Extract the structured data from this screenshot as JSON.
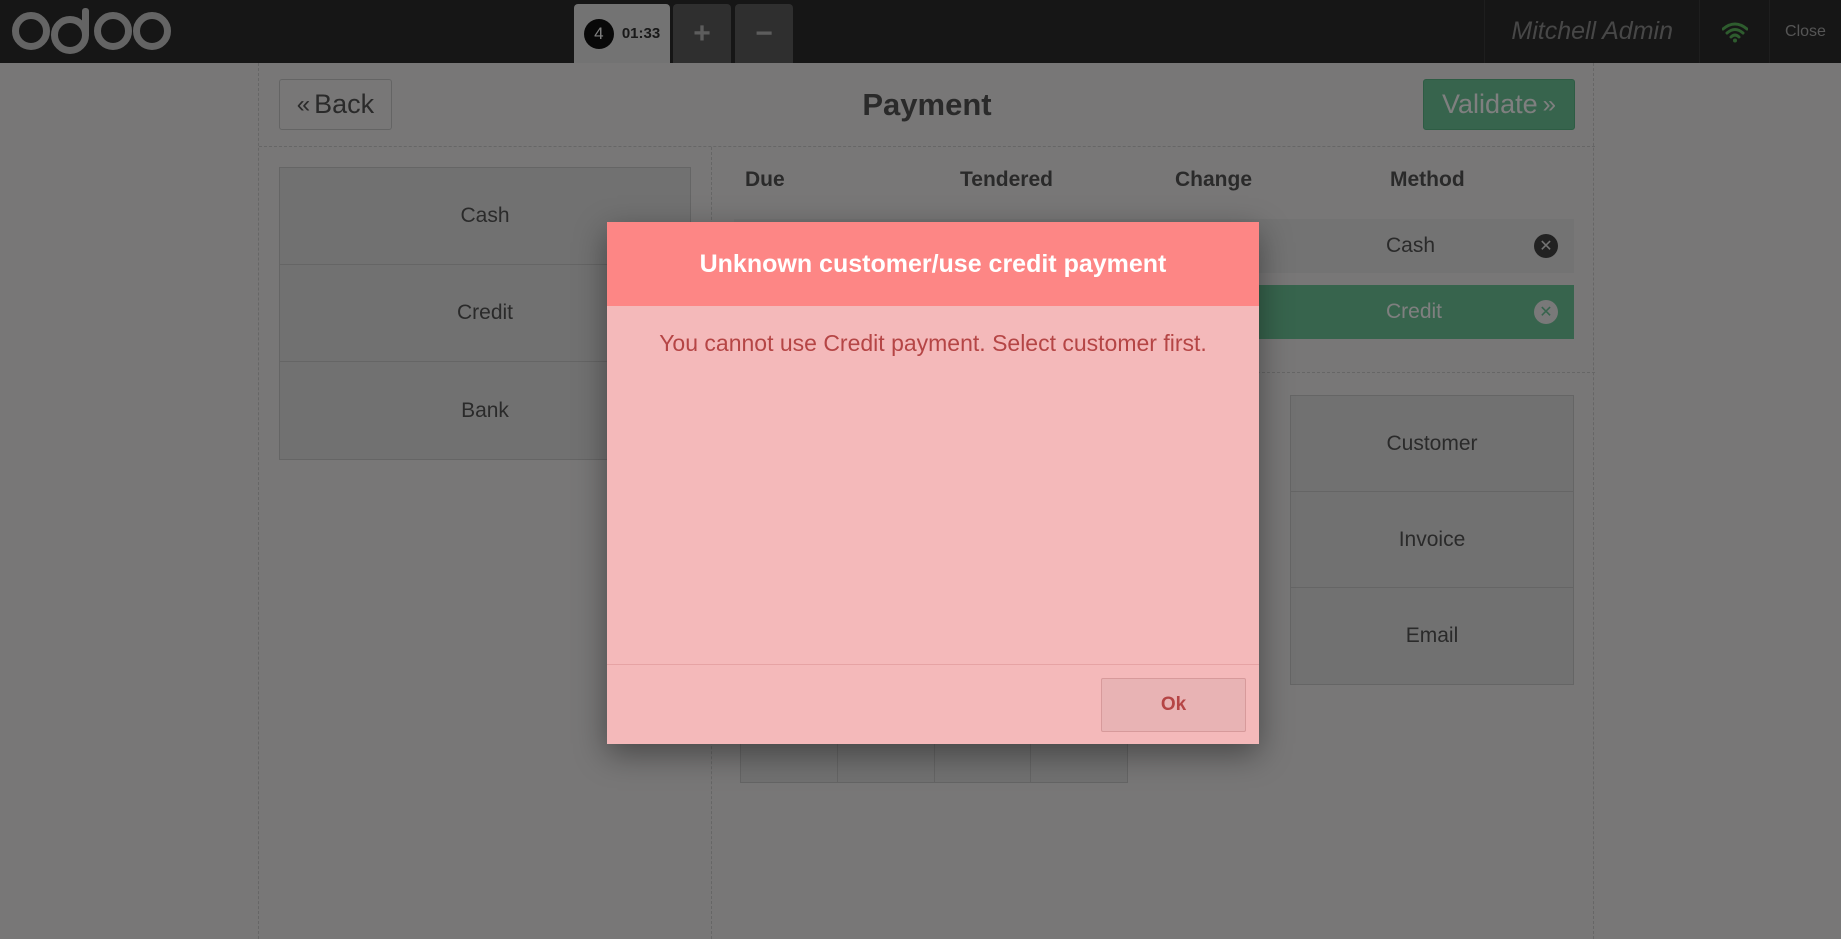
{
  "topbar": {
    "order_number": "4",
    "order_time": "01:33",
    "add_order_label": "+",
    "remove_order_label": "−",
    "user_name": "Mitchell Admin",
    "close_label": "Close",
    "wifi_color": "#5cb85c"
  },
  "payment_screen": {
    "back_label": "Back",
    "title": "Payment",
    "validate_label": "Validate",
    "payment_methods": [
      "Cash",
      "Credit",
      "Bank"
    ],
    "columns": {
      "due": "Due",
      "tendered": "Tendered",
      "change": "Change",
      "method": "Method"
    },
    "payment_lines": [
      {
        "method": "Cash"
      },
      {
        "method": "Credit"
      }
    ],
    "options": [
      "Customer",
      "Invoice",
      "Email"
    ]
  },
  "dialog": {
    "title": "Unknown customer/use credit payment",
    "body": "You cannot use Credit payment. Select customer first.",
    "ok_label": "Ok",
    "header_color": "#fd8685",
    "body_color": "#f4b9ba"
  }
}
